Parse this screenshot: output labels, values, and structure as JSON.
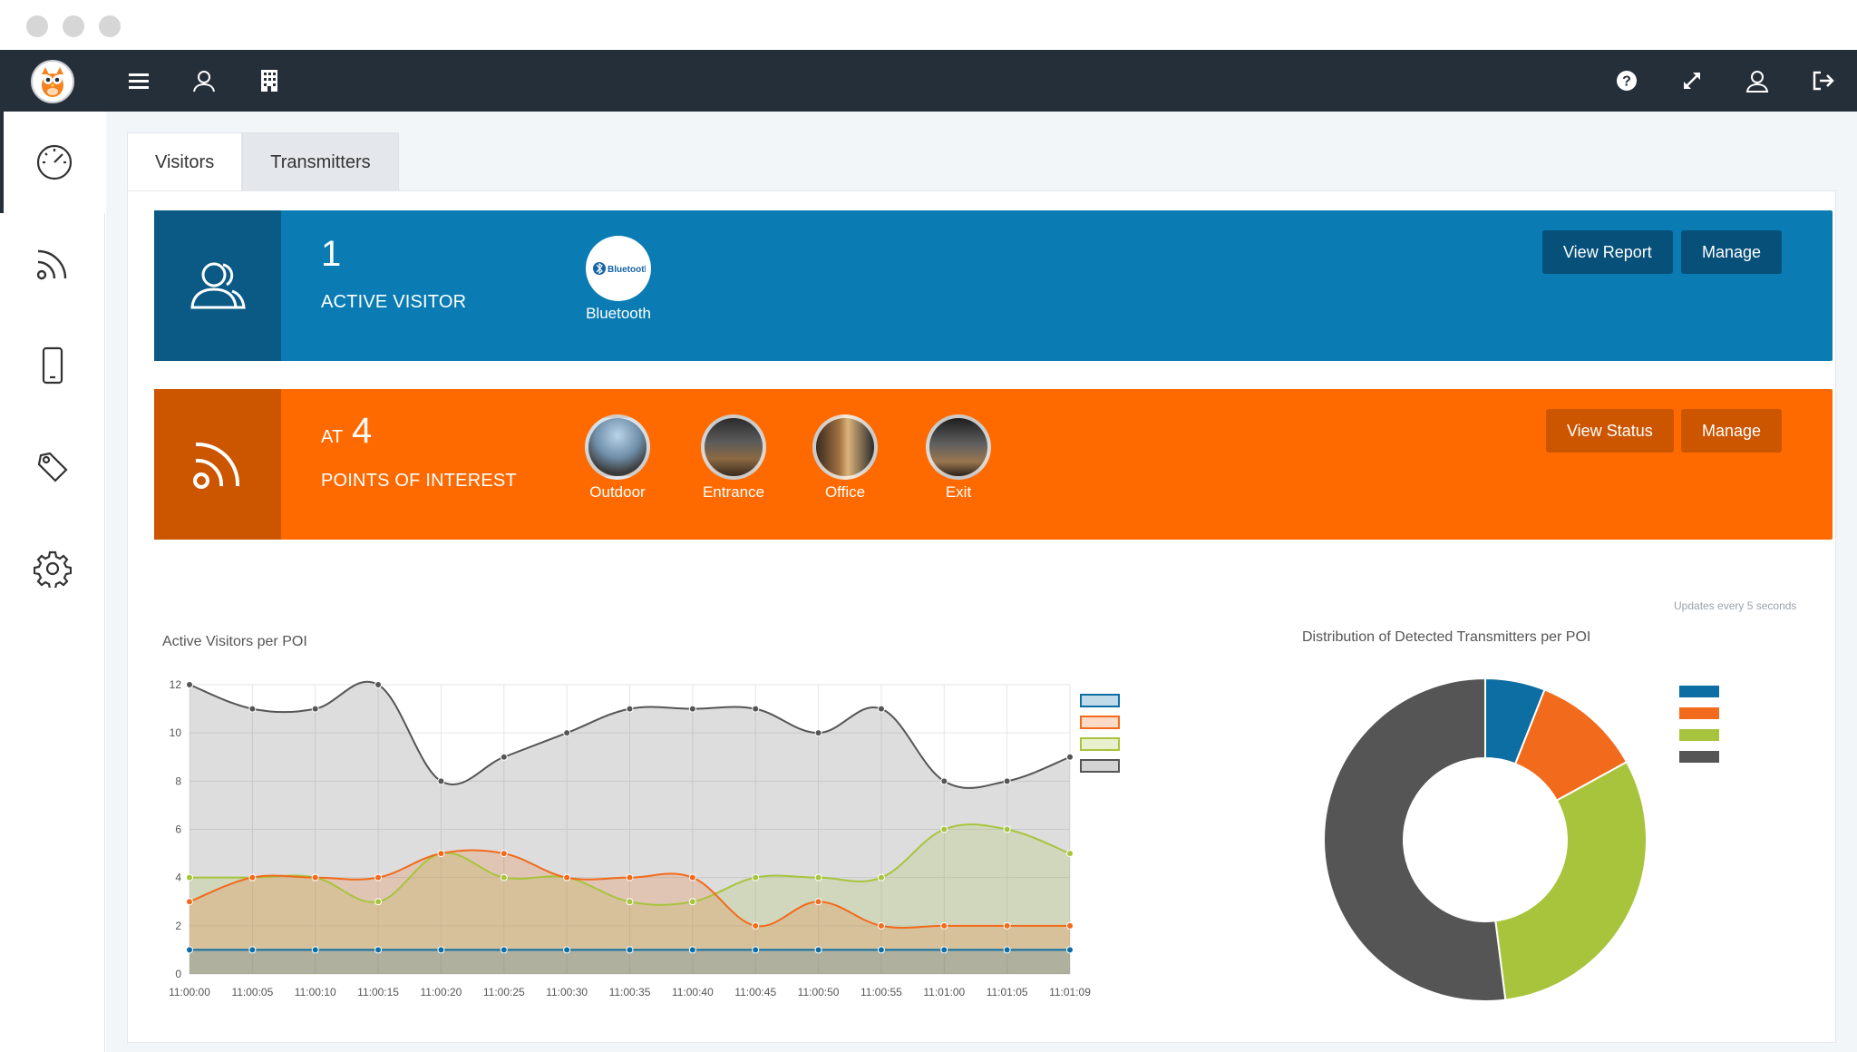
{
  "window": {
    "controls": [
      "close",
      "minimize",
      "maximize"
    ]
  },
  "topbar": {
    "logo": "owl-logo",
    "left_icons": [
      "menu-icon",
      "user-icon",
      "building-icon"
    ],
    "right_icons": [
      "help-icon",
      "expand-icon",
      "profile-icon",
      "logout-icon"
    ]
  },
  "sidebar": {
    "items": [
      {
        "icon": "dashboard-gauge-icon",
        "active": true
      },
      {
        "icon": "rss-icon",
        "active": false
      },
      {
        "icon": "mobile-icon",
        "active": false
      },
      {
        "icon": "tag-icon",
        "active": false
      },
      {
        "icon": "gear-icon",
        "active": false
      }
    ]
  },
  "tabs": [
    {
      "label": "Visitors",
      "active": true
    },
    {
      "label": "Transmitters",
      "active": false
    }
  ],
  "visitors_banner": {
    "color": "#0a7cb3",
    "icon_box_color": "#0a5a85",
    "count": "1",
    "label": "ACTIVE VISITOR",
    "tech": {
      "name": "Bluetooth",
      "logo_text": "Bluetooth"
    },
    "btn_view": "View Report",
    "btn_manage": "Manage"
  },
  "poi_banner": {
    "color": "#ff6a00",
    "icon_box_color": "#cc5500",
    "prefix": "AT",
    "count": "4",
    "label": "POINTS OF INTEREST",
    "pois": [
      "Outdoor",
      "Entrance",
      "Office",
      "Exit"
    ],
    "btn_view": "View Status",
    "btn_manage": "Manage"
  },
  "updates_note": "Updates every 5 seconds",
  "line_chart_title": "Active Visitors per POI",
  "donut_chart_title": "Distribution of Detected Transmitters per POI",
  "chart_data": [
    {
      "type": "area",
      "title": "Active Visitors per POI",
      "categories": [
        "11:00:00",
        "11:00:05",
        "11:00:10",
        "11:00:15",
        "11:00:20",
        "11:00:25",
        "11:00:30",
        "11:00:35",
        "11:00:40",
        "11:00:45",
        "11:00:50",
        "11:00:55",
        "11:01:00",
        "11:01:05",
        "11:01:09"
      ],
      "ylim": [
        0,
        12
      ],
      "yticks": [
        0,
        2,
        4,
        6,
        8,
        10,
        12
      ],
      "grid": true,
      "legend": "right",
      "series": [
        {
          "color": "#0d6ea3",
          "values": [
            1,
            1,
            1,
            1,
            1,
            1,
            1,
            1,
            1,
            1,
            1,
            1,
            1,
            1,
            1
          ]
        },
        {
          "color": "#f26a1b",
          "values": [
            3,
            4,
            4,
            4,
            5,
            5,
            4,
            4,
            4,
            2,
            3,
            2,
            2,
            2,
            2
          ]
        },
        {
          "color": "#a7c43c",
          "values": [
            4,
            4,
            4,
            3,
            5,
            4,
            4,
            3,
            3,
            4,
            4,
            4,
            6,
            6,
            5
          ]
        },
        {
          "color": "#555555",
          "values": [
            12,
            11,
            11,
            12,
            8,
            9,
            10,
            11,
            11,
            11,
            10,
            11,
            8,
            8,
            9
          ]
        }
      ]
    },
    {
      "type": "pie",
      "title": "Distribution of Detected Transmitters per POI",
      "donut": true,
      "legend": "right",
      "slices": [
        {
          "color": "#0d6ea3",
          "value": 6
        },
        {
          "color": "#f26a1b",
          "value": 11
        },
        {
          "color": "#a7c43c",
          "value": 31
        },
        {
          "color": "#555555",
          "value": 52
        }
      ]
    }
  ]
}
